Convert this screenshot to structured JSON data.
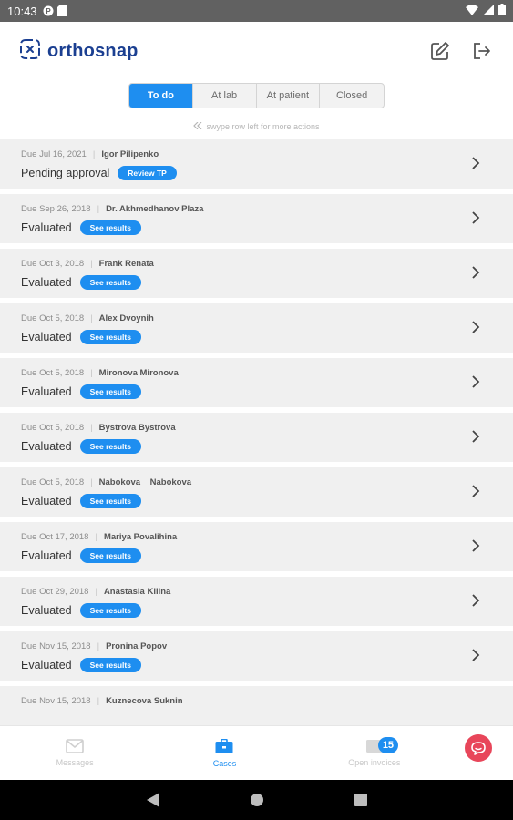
{
  "status_bar": {
    "time": "10:43"
  },
  "brand": {
    "name": "orthosnap"
  },
  "tabs": [
    {
      "label": "To do",
      "active": true
    },
    {
      "label": "At lab",
      "active": false
    },
    {
      "label": "At patient",
      "active": false
    },
    {
      "label": "Closed",
      "active": false
    }
  ],
  "swipe_hint": "swype row left for more actions",
  "cases": [
    {
      "due": "Due Jul 16, 2021",
      "patient": "Igor Pilipenko",
      "status": "Pending approval",
      "action": "Review TP"
    },
    {
      "due": "Due Sep 26, 2018",
      "patient": "Dr. Akhmedhanov Plaza",
      "status": "Evaluated",
      "action": "See results"
    },
    {
      "due": "Due Oct 3, 2018",
      "patient": "Frank Renata",
      "status": "Evaluated",
      "action": "See results"
    },
    {
      "due": "Due Oct 5, 2018",
      "patient": "Alex Dvoynih",
      "status": "Evaluated",
      "action": "See results"
    },
    {
      "due": "Due Oct 5, 2018",
      "patient": "Mironova Mironova",
      "status": "Evaluated",
      "action": "See results"
    },
    {
      "due": "Due Oct 5, 2018",
      "patient": "Bystrova Bystrova",
      "status": "Evaluated",
      "action": "See results"
    },
    {
      "due": "Due Oct 5, 2018",
      "patient": "Nabokova    Nabokova",
      "status": "Evaluated",
      "action": "See results"
    },
    {
      "due": "Due Oct 17, 2018",
      "patient": "Mariya Povalihina",
      "status": "Evaluated",
      "action": "See results"
    },
    {
      "due": "Due Oct 29, 2018",
      "patient": "Anastasia Kilina",
      "status": "Evaluated",
      "action": "See results"
    },
    {
      "due": "Due Nov 15, 2018",
      "patient": "Pronina Popov",
      "status": "Evaluated",
      "action": "See results"
    },
    {
      "due": "Due Nov 15, 2018",
      "patient": "Kuznecova Suknin",
      "status": "",
      "action": ""
    }
  ],
  "bottom_nav": {
    "messages": {
      "label": "Messages"
    },
    "cases": {
      "label": "Cases"
    },
    "invoices": {
      "label": "Open invoices",
      "badge": "15"
    }
  },
  "colors": {
    "accent": "#1e8ef0",
    "brand": "#1b3f91",
    "fab": "#e8465a"
  }
}
